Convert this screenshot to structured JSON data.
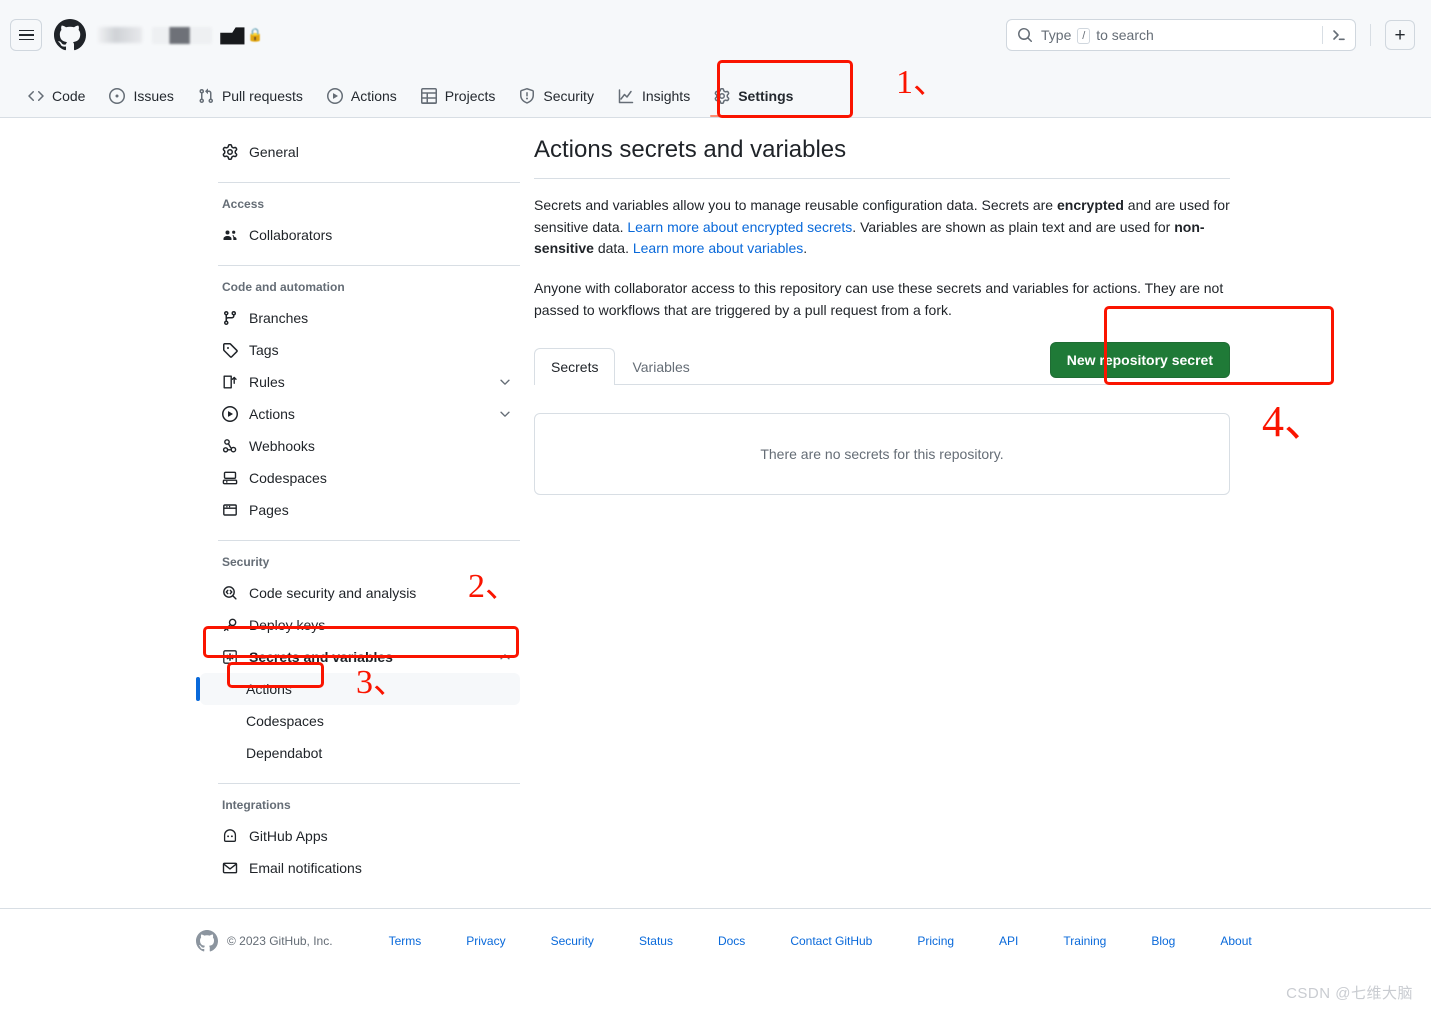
{
  "header": {
    "menu_label": "Open menu",
    "logo_name": "github-logo",
    "repo_breadcrumb_redacted": true,
    "search": {
      "placeholder_prefix": "Type",
      "placeholder_key": "/",
      "placeholder_suffix": "to search",
      "value": ""
    },
    "plus_label": "+"
  },
  "repo_nav": {
    "tabs": [
      {
        "label": "Code",
        "icon": "code-icon",
        "active": false
      },
      {
        "label": "Issues",
        "icon": "issue-opened-icon",
        "active": false
      },
      {
        "label": "Pull requests",
        "icon": "git-pull-request-icon",
        "active": false
      },
      {
        "label": "Actions",
        "icon": "play-icon",
        "active": false
      },
      {
        "label": "Projects",
        "icon": "table-icon",
        "active": false
      },
      {
        "label": "Security",
        "icon": "shield-icon",
        "active": false
      },
      {
        "label": "Insights",
        "icon": "graph-icon",
        "active": false
      },
      {
        "label": "Settings",
        "icon": "gear-icon",
        "active": true
      }
    ]
  },
  "sidebar": {
    "general": {
      "label": "General",
      "icon": "gear-icon"
    },
    "sections": [
      {
        "title": "Access",
        "items": [
          {
            "label": "Collaborators",
            "icon": "people-icon"
          }
        ]
      },
      {
        "title": "Code and automation",
        "items": [
          {
            "label": "Branches",
            "icon": "git-branch-icon"
          },
          {
            "label": "Tags",
            "icon": "tag-icon"
          },
          {
            "label": "Rules",
            "icon": "rules-icon",
            "chevron": "chevron-down"
          },
          {
            "label": "Actions",
            "icon": "play-icon",
            "chevron": "chevron-down"
          },
          {
            "label": "Webhooks",
            "icon": "webhook-icon"
          },
          {
            "label": "Codespaces",
            "icon": "codespaces-icon"
          },
          {
            "label": "Pages",
            "icon": "browser-icon"
          }
        ]
      },
      {
        "title": "Security",
        "items": [
          {
            "label": "Code security and analysis",
            "icon": "code-scan-icon"
          },
          {
            "label": "Deploy keys",
            "icon": "key-icon"
          },
          {
            "label": "Secrets and variables",
            "icon": "asterisk-box-icon",
            "chevron": "chevron-up",
            "expanded": true,
            "bold": true
          }
        ],
        "subitems": [
          {
            "label": "Actions",
            "selected": true
          },
          {
            "label": "Codespaces",
            "selected": false
          },
          {
            "label": "Dependabot",
            "selected": false
          }
        ]
      },
      {
        "title": "Integrations",
        "items": [
          {
            "label": "GitHub Apps",
            "icon": "apps-icon"
          },
          {
            "label": "Email notifications",
            "icon": "mail-icon"
          }
        ]
      }
    ]
  },
  "main": {
    "title": "Actions secrets and variables",
    "paragraph1": {
      "t1": "Secrets and variables allow you to manage reusable configuration data. Secrets are ",
      "b1": "encrypted",
      "t2": " and are used for sensitive data. ",
      "link1": "Learn more about encrypted secrets",
      "t3": ". Variables are shown as plain text and are used for ",
      "b2": "non-sensitive",
      "t4": " data. ",
      "link2": "Learn more about variables",
      "t5": "."
    },
    "paragraph2": "Anyone with collaborator access to this repository can use these secrets and variables for actions. They are not passed to workflows that are triggered by a pull request from a fork.",
    "tabs": [
      {
        "label": "Secrets",
        "active": true
      },
      {
        "label": "Variables",
        "active": false
      }
    ],
    "new_secret_button": "New repository secret",
    "empty_state": "There are no secrets for this repository."
  },
  "footer": {
    "copyright": "© 2023 GitHub, Inc.",
    "links": [
      "Terms",
      "Privacy",
      "Security",
      "Status",
      "Docs",
      "Contact GitHub",
      "Pricing",
      "API",
      "Training",
      "Blog",
      "About"
    ]
  },
  "watermark": "CSDN @七维大脑",
  "annotations": {
    "step1": "1、",
    "step2": "2、",
    "step3": "3、",
    "step4": "4、",
    "accent_color": "#fa1400"
  }
}
